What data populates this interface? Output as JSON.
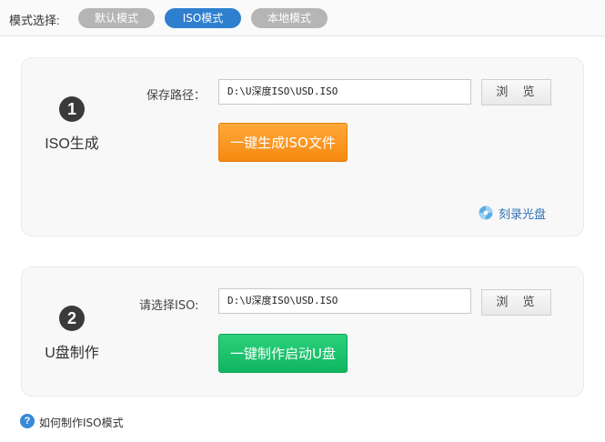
{
  "mode": {
    "label": "模式选择:",
    "options": [
      "默认模式",
      "ISO模式",
      "本地模式"
    ],
    "selected": "ISO模式"
  },
  "step1": {
    "number": "1",
    "title": "ISO生成",
    "field_label": "保存路径：",
    "path_value": "D:\\U深度ISO\\USD.ISO",
    "browse_label": "浏 览",
    "action_label": "一键生成ISO文件",
    "burn_label": "刻录光盘"
  },
  "step2": {
    "number": "2",
    "title": "U盘制作",
    "field_label": "请选择ISO:",
    "path_value": "D:\\U深度ISO\\USD.ISO",
    "browse_label": "浏 览",
    "action_label": "一键制作启动U盘"
  },
  "help": {
    "icon_glyph": "?",
    "label": "如何制作ISO模式"
  },
  "colors": {
    "accent": "#2f7fcf",
    "orange_button": "#f58a10",
    "green_button": "#10b561",
    "inactive_mode": "#b5b5b5"
  }
}
